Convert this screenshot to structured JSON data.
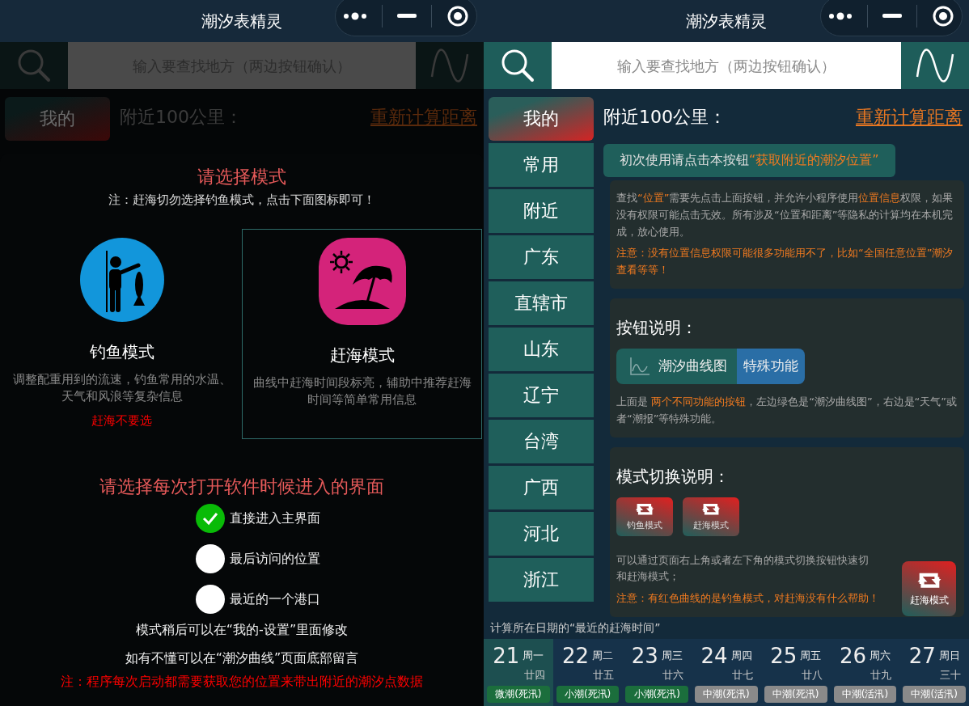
{
  "left_screen": {
    "title": "潮汐表精灵",
    "search": {
      "placeholder": "输入要查找地方（两边按钮确认）"
    },
    "sidebar": {
      "items": [
        {
          "label": "我的",
          "selected": true
        }
      ]
    },
    "heading": "附近100公里：",
    "recalc_link": "重新计算距离",
    "mode_dialog": {
      "title": "请选择模式",
      "note": "注：赶海切勿选择钓鱼模式，点击下面图标即可！",
      "modes": [
        {
          "kind": "fishing",
          "label": "钓鱼模式",
          "description": "调整配重用到的流速，钓鱼常用的水温、天气和风浪等复杂信息",
          "warning": "赶海不要选",
          "selected": false
        },
        {
          "kind": "beach",
          "label": "赶海模式",
          "description": "曲线中赶海时间段标亮，辅助中推荐赶海时间等简单常用信息",
          "selected": true
        }
      ],
      "start_title": "请选择每次打开软件时候进入的界面",
      "start_options": [
        {
          "label": "直接进入主界面",
          "checked": true
        },
        {
          "label": "最后访问的位置",
          "checked": false
        },
        {
          "label": "最近的一个港口",
          "checked": false
        }
      ],
      "hints": [
        "模式稍后可以在“我的-设置”里面修改",
        "如有不懂可以在“潮汐曲线”页面底部留言"
      ],
      "footer_note": "注：程序每次启动都需要获取您的位置来带出附近的潮汐点数据"
    }
  },
  "right_screen": {
    "title": "潮汐表精灵",
    "search": {
      "placeholder": "输入要查找地方（两边按钮确认）"
    },
    "sidebar": {
      "items": [
        {
          "label": "我的",
          "selected": true
        },
        {
          "label": "常用",
          "selected": false
        },
        {
          "label": "附近",
          "selected": false
        },
        {
          "label": "广东",
          "selected": false
        },
        {
          "label": "直辖市",
          "selected": false
        },
        {
          "label": "山东",
          "selected": false
        },
        {
          "label": "辽宁",
          "selected": false
        },
        {
          "label": "台湾",
          "selected": false
        },
        {
          "label": "广西",
          "selected": false
        },
        {
          "label": "河北",
          "selected": false
        },
        {
          "label": "浙江",
          "selected": false
        }
      ]
    },
    "heading": "附近100公里：",
    "recalc_link": "重新计算距离",
    "locate_button": {
      "text": "初次使用请点击本按钮",
      "highlight": "“获取附近的潮汐位置”"
    },
    "location_card": {
      "paragraph": [
        {
          "text": "查找",
          "highlight": false
        },
        {
          "text": "“位置”",
          "highlight": true
        },
        {
          "text": "需要先点击上面按钮，并允许小程序使用",
          "highlight": false
        },
        {
          "text": "位置信息",
          "highlight": true
        },
        {
          "text": "权限，如果没有权限可能点击无效。所有涉及“位置和距离”等隐私的计算均在本机完成，放心使用。",
          "highlight": false
        }
      ],
      "warning": "注意：没有位置信息权限可能很多功能用不了，比如“全国任意位置”潮汐查看等等！"
    },
    "buttons_card": {
      "title": "按钮说明：",
      "chart_button": "潮汐曲线图",
      "special_button": "特殊功能",
      "paragraph": [
        {
          "text": "上面是 ",
          "highlight": false
        },
        {
          "text": "两个不同功能的按钮",
          "highlight": true
        },
        {
          "text": "，左边绿色是“潮汐曲线图”，右边是“天气”或者“潮报”等特殊功能。",
          "highlight": false
        }
      ]
    },
    "mode_card": {
      "title": "模式切换说明：",
      "mode_buttons": [
        "钓鱼模式",
        "赶海模式"
      ],
      "lines": [
        "可以通过页面右上角或者左下角的模式切换按钮快速切",
        "和赶海模式；"
      ],
      "warning": "注意：有红色曲线的是钓鱼模式，对赶海没有什么帮助！"
    },
    "caption": "计算所在日期的“最近的赶海时间”",
    "floating_mode_button": "赶海模式",
    "days": [
      {
        "date": "21",
        "weekday": "周一",
        "lunar": "廿四",
        "tide": "微潮(死汛)",
        "color": "#1b6e3c",
        "selected": true
      },
      {
        "date": "22",
        "weekday": "周二",
        "lunar": "廿五",
        "tide": "小潮(死汛)",
        "color": "#1b6e3c",
        "selected": false
      },
      {
        "date": "23",
        "weekday": "周三",
        "lunar": "廿六",
        "tide": "小潮(死汛)",
        "color": "#1b6e3c",
        "selected": false
      },
      {
        "date": "24",
        "weekday": "周四",
        "lunar": "廿七",
        "tide": "中潮(死汛)",
        "color": "#8a8a8a",
        "selected": false
      },
      {
        "date": "25",
        "weekday": "周五",
        "lunar": "廿八",
        "tide": "中潮(死汛)",
        "color": "#8a8a8a",
        "selected": false
      },
      {
        "date": "26",
        "weekday": "周六",
        "lunar": "廿九",
        "tide": "中潮(活汛)",
        "color": "#8a8a8a",
        "selected": false
      },
      {
        "date": "27",
        "weekday": "周日",
        "lunar": "三十",
        "tide": "中潮(活汛)",
        "color": "#8a8a8a",
        "selected": false
      }
    ]
  }
}
